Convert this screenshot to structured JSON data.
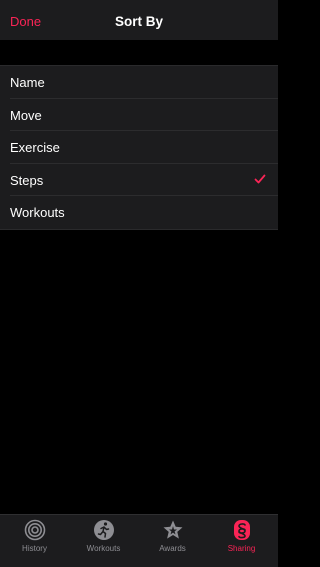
{
  "nav": {
    "done_label": "Done",
    "title": "Sort By"
  },
  "sort_options": [
    {
      "label": "Name",
      "selected": false
    },
    {
      "label": "Move",
      "selected": false
    },
    {
      "label": "Exercise",
      "selected": false
    },
    {
      "label": "Steps",
      "selected": true
    },
    {
      "label": "Workouts",
      "selected": false
    }
  ],
  "tabs": [
    {
      "label": "History",
      "icon": "rings-icon",
      "active": false
    },
    {
      "label": "Workouts",
      "icon": "runner-icon",
      "active": false
    },
    {
      "label": "Awards",
      "icon": "star-icon",
      "active": false
    },
    {
      "label": "Sharing",
      "icon": "sharing-icon",
      "active": true
    }
  ],
  "colors": {
    "accent": "#fa2456",
    "background": "#000000",
    "surface": "#1c1c1e",
    "inactive": "#8e8e93"
  }
}
